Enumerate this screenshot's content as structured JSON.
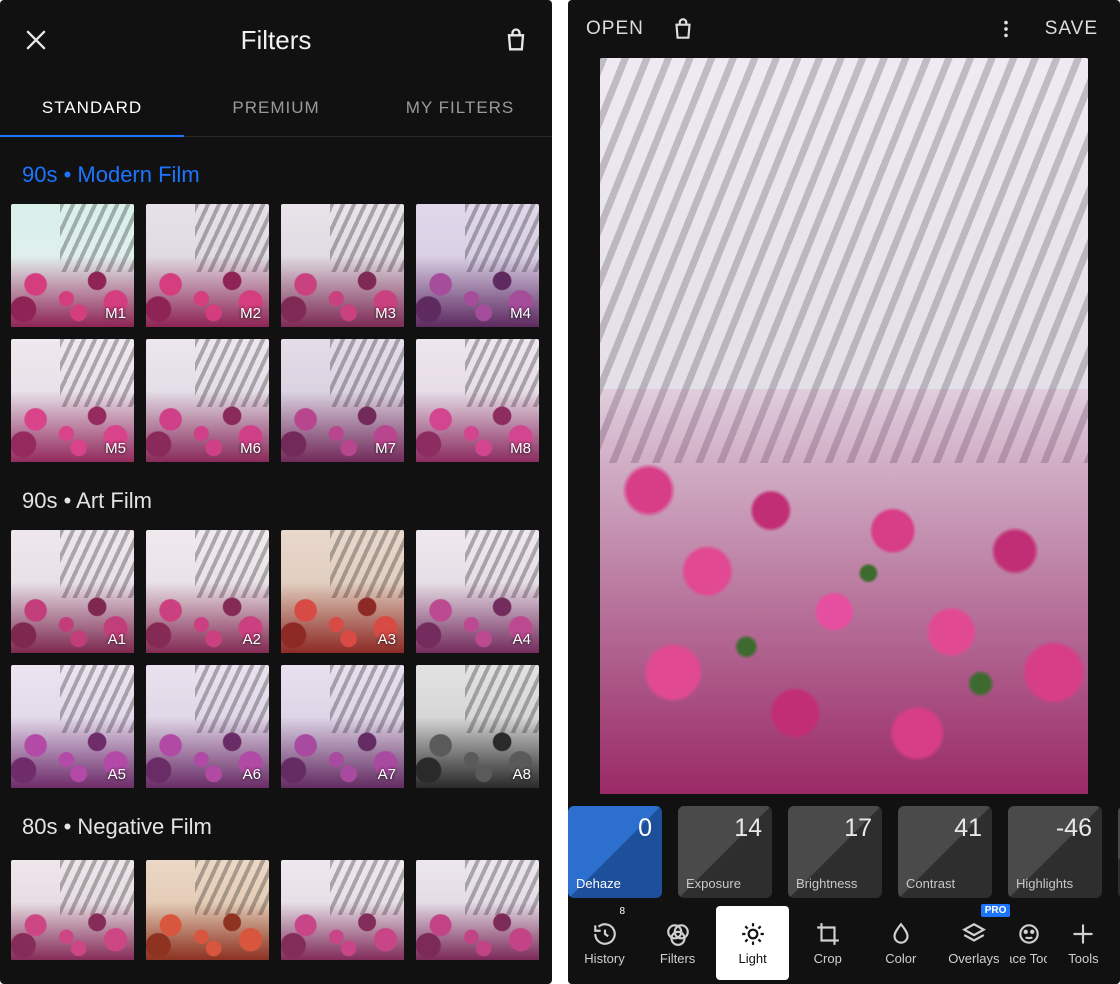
{
  "left": {
    "title": "Filters",
    "tabs": [
      "STANDARD",
      "PREMIUM",
      "MY FILTERS"
    ],
    "groups": [
      {
        "title": "90s • Modern Film",
        "active": true,
        "items": [
          {
            "label": "M1",
            "skyA": "#d9f0ea",
            "skyB": "#e8eef0",
            "fA": "#d43d7e",
            "fB": "#8e2455"
          },
          {
            "label": "M2",
            "skyA": "#e6e1e8",
            "skyB": "#d8d3da",
            "fA": "#d43d7e",
            "fB": "#8e2455"
          },
          {
            "label": "M3",
            "skyA": "#e9e4ea",
            "skyB": "#d5d0d8",
            "fA": "#c9427f",
            "fB": "#7e2a55"
          },
          {
            "label": "M4",
            "skyA": "#e0d8ea",
            "skyB": "#cfc5de",
            "fA": "#a54d9a",
            "fB": "#5e2a60"
          },
          {
            "label": "M5",
            "skyA": "#efe8ee",
            "skyB": "#ded8e2",
            "fA": "#d8438a",
            "fB": "#942a5e"
          },
          {
            "label": "M6",
            "skyA": "#ece7ee",
            "skyB": "#d8d2de",
            "fA": "#d04088",
            "fB": "#8a2a5a"
          },
          {
            "label": "M7",
            "skyA": "#e4dce8",
            "skyB": "#d0c8d8",
            "fA": "#b8468e",
            "fB": "#722a5a"
          },
          {
            "label": "M8",
            "skyA": "#eee6ee",
            "skyB": "#dcd2de",
            "fA": "#d24690",
            "fB": "#8c2c60"
          }
        ]
      },
      {
        "title": "90s • Art Film",
        "items": [
          {
            "label": "A1",
            "skyA": "#eee8ee",
            "skyB": "#ded6de",
            "fA": "#c23e7a",
            "fB": "#7e2850"
          },
          {
            "label": "A2",
            "skyA": "#f0eaee",
            "skyB": "#e0d8dc",
            "fA": "#ca4080",
            "fB": "#842a54"
          },
          {
            "label": "A3",
            "skyA": "#e8d8cc",
            "skyB": "#d8c2b0",
            "fA": "#d84a44",
            "fB": "#8e2a26"
          },
          {
            "label": "A4",
            "skyA": "#efe8ee",
            "skyB": "#dbd2dc",
            "fA": "#bc4a90",
            "fB": "#742c5e"
          },
          {
            "label": "A5",
            "skyA": "#ece4f0",
            "skyB": "#d6cce2",
            "fA": "#b44aa8",
            "fB": "#6e2c6a"
          },
          {
            "label": "A6",
            "skyA": "#eae2ee",
            "skyB": "#d4cade",
            "fA": "#b04aa4",
            "fB": "#6a2c66"
          },
          {
            "label": "A7",
            "skyA": "#e8e0ee",
            "skyB": "#d0c6dc",
            "fA": "#a84aa0",
            "fB": "#642c62"
          },
          {
            "label": "A8",
            "skyA": "#e2e2e2",
            "skyB": "#c8c8c8",
            "fA": "#5a5a5a",
            "fB": "#2a2a2a"
          }
        ]
      },
      {
        "title": "80s • Negative Film",
        "partial": true,
        "items": [
          {
            "label": "",
            "skyA": "#eee6ea",
            "skyB": "#dcd2d8",
            "fA": "#cc4684",
            "fB": "#862c58"
          },
          {
            "label": "",
            "skyA": "#ecd8c6",
            "skyB": "#d8bea4",
            "fA": "#d8563e",
            "fB": "#8e3222"
          },
          {
            "label": "",
            "skyA": "#eee8ee",
            "skyB": "#dcd4de",
            "fA": "#c84688",
            "fB": "#822c5a"
          },
          {
            "label": "",
            "skyA": "#ece6ee",
            "skyB": "#d8d0dc",
            "fA": "#c24486",
            "fB": "#7c2a58"
          }
        ]
      }
    ]
  },
  "right": {
    "header": {
      "open": "OPEN",
      "save": "SAVE"
    },
    "sliders": [
      {
        "name": "Dehaze",
        "value": "0",
        "selected": true
      },
      {
        "name": "Exposure",
        "value": "14"
      },
      {
        "name": "Brightness",
        "value": "17"
      },
      {
        "name": "Contrast",
        "value": "41"
      },
      {
        "name": "Highlights",
        "value": "-46"
      }
    ],
    "toolbar": [
      {
        "label": "History",
        "badge": "8"
      },
      {
        "label": "Filters"
      },
      {
        "label": "Light",
        "active": true
      },
      {
        "label": "Crop"
      },
      {
        "label": "Color"
      },
      {
        "label": "Overlays",
        "badge": "PRO"
      },
      {
        "label": "Face Tools"
      },
      {
        "label": "Tools"
      }
    ]
  }
}
